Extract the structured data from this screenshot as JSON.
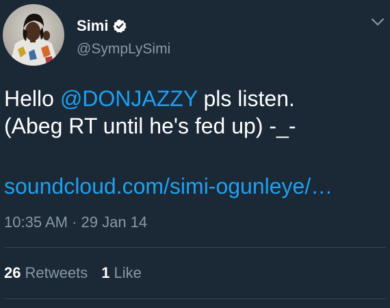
{
  "user": {
    "display_name": "Simi",
    "handle": "@SympLySimi",
    "verified_icon": "verified-badge-icon"
  },
  "tweet": {
    "text_prefix": "Hello ",
    "mention": "@DONJAZZY",
    "text_after_mention": " pls listen.",
    "line2": "(Abeg RT until he's fed up) -_-",
    "link": "soundcloud.com/simi-ogunleye/…",
    "timestamp": "10:35 AM · 29 Jan 14"
  },
  "stats": {
    "retweets_count": "26",
    "retweets_label": "Retweets",
    "likes_count": "1",
    "likes_label": "Like"
  },
  "colors": {
    "background": "#1b2836",
    "link_blue": "#1da1f2",
    "secondary_text": "#8899a6",
    "divider": "#38444d"
  }
}
